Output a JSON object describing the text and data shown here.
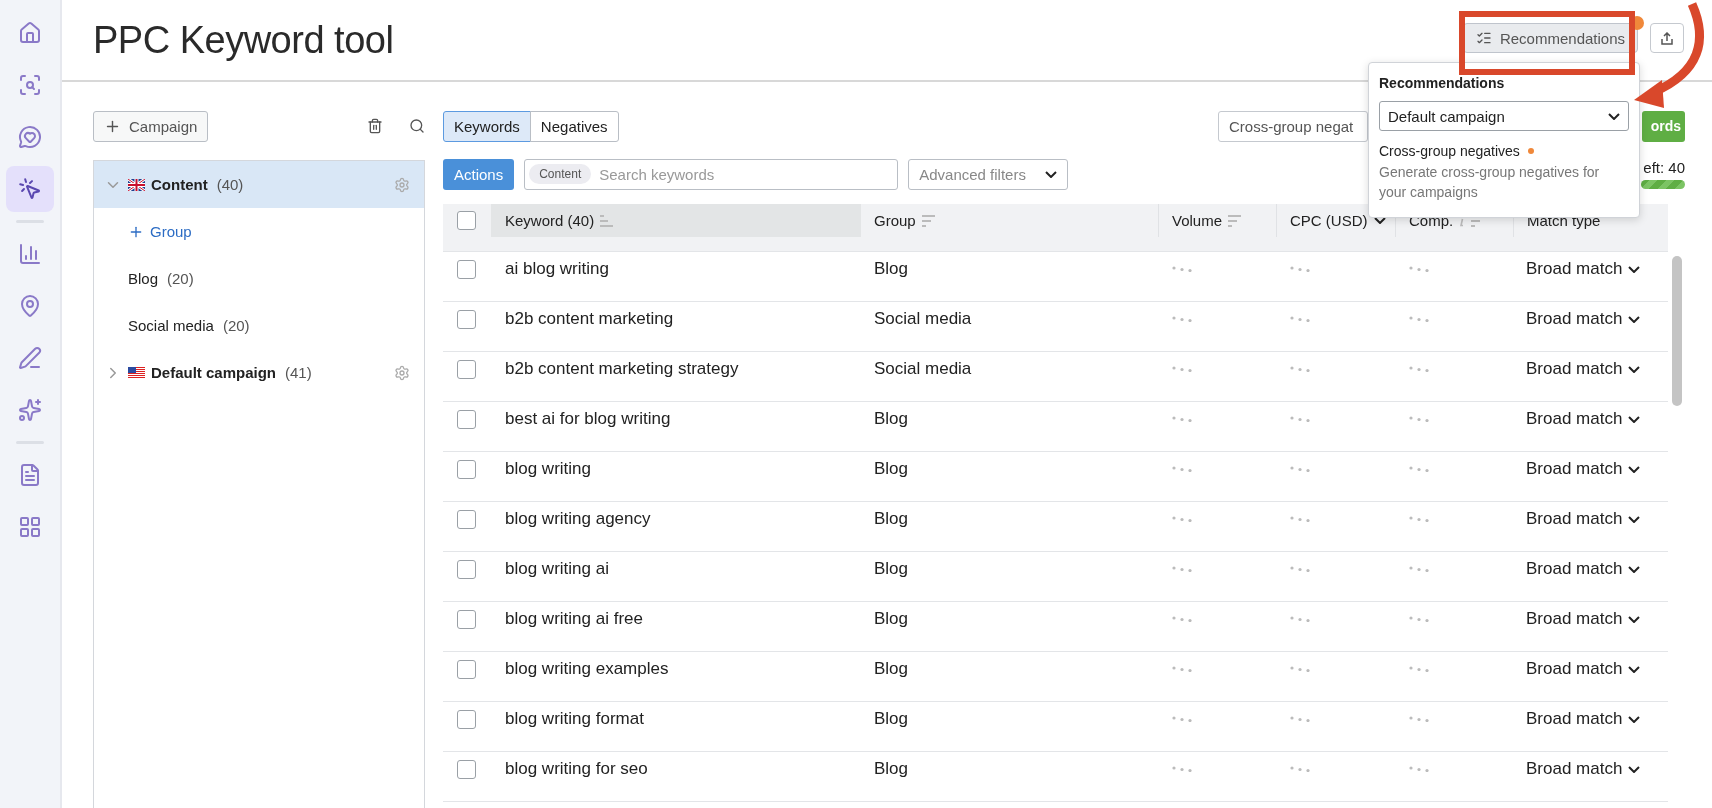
{
  "nav": [
    {
      "selected": false
    },
    {
      "selected": false
    },
    {
      "selected": false
    },
    {
      "selected": true
    },
    {
      "selected": false
    },
    {
      "selected": false
    },
    {
      "selected": false
    },
    {
      "selected": false
    },
    {
      "selected": false
    },
    {
      "selected": false
    }
  ],
  "title": "PPC Keyword tool",
  "header_actions": {
    "recommendations": "Recommendations",
    "has_notification": true
  },
  "recommendations_popover": {
    "title": "Recommendations",
    "campaign_select": "Default campaign",
    "item": {
      "title": "Cross-group negatives",
      "new": true,
      "description": "Generate cross-group negatives for your campaigns"
    }
  },
  "campaign_panel": {
    "add_button": "Campaign",
    "tree": [
      {
        "kind": "campaign",
        "flag": {
          "kind": "uk"
        },
        "name": "Content",
        "count": "(40)",
        "expanded": true,
        "selected": true,
        "children": [
          {
            "kind": "add",
            "label": "Group"
          },
          {
            "kind": "group",
            "name": "Blog",
            "count": "(20)"
          },
          {
            "kind": "group",
            "name": "Social media",
            "count": "(20)"
          }
        ]
      },
      {
        "kind": "campaign",
        "flag": {
          "kind": "us"
        },
        "name": "Default campaign",
        "count": "(41)",
        "expanded": false,
        "selected": false
      }
    ]
  },
  "tabs": [
    {
      "label": "Keywords",
      "selected": true
    },
    {
      "label": "Negatives",
      "selected": false
    }
  ],
  "cross_group_field": "Cross-group negat",
  "green_button": "ords",
  "keywords_left": {
    "label": "eft: 40",
    "level": 1
  },
  "actions_button": "Actions",
  "search": {
    "chip": "Content",
    "placeholder": "Search keywords"
  },
  "filters": "Advanced filters",
  "table": {
    "all_checked": false,
    "columns": [
      {
        "label": "Keyword (40)",
        "sort": {
          "kind": "active"
        }
      },
      {
        "label": "Group",
        "sort": {
          "kind": "lines"
        }
      },
      {
        "label": "Volume",
        "sort": {
          "kind": "lines"
        }
      },
      {
        "label": "CPC (USD)",
        "sort": {
          "kind": "dropdown"
        }
      },
      {
        "label": "Comp.",
        "sort": {
          "kind": "lines"
        },
        "info": true
      },
      {
        "label": "Match type",
        "sort": {
          "kind": "none"
        }
      }
    ],
    "rows": [
      {
        "checked": false,
        "keyword": "ai blog writing",
        "group": "Blog",
        "match": "Broad match"
      },
      {
        "checked": false,
        "keyword": "b2b content marketing",
        "group": "Social media",
        "match": "Broad match"
      },
      {
        "checked": false,
        "keyword": "b2b content marketing strategy",
        "group": "Social media",
        "match": "Broad match"
      },
      {
        "checked": false,
        "keyword": "best ai for blog writing",
        "group": "Blog",
        "match": "Broad match"
      },
      {
        "checked": false,
        "keyword": "blog writing",
        "group": "Blog",
        "match": "Broad match"
      },
      {
        "checked": false,
        "keyword": "blog writing agency",
        "group": "Blog",
        "match": "Broad match"
      },
      {
        "checked": false,
        "keyword": "blog writing ai",
        "group": "Blog",
        "match": "Broad match"
      },
      {
        "checked": false,
        "keyword": "blog writing ai free",
        "group": "Blog",
        "match": "Broad match"
      },
      {
        "checked": false,
        "keyword": "blog writing examples",
        "group": "Blog",
        "match": "Broad match"
      },
      {
        "checked": false,
        "keyword": "blog writing format",
        "group": "Blog",
        "match": "Broad match"
      },
      {
        "checked": false,
        "keyword": "blog writing for seo",
        "group": "Blog",
        "match": "Broad match"
      }
    ]
  }
}
